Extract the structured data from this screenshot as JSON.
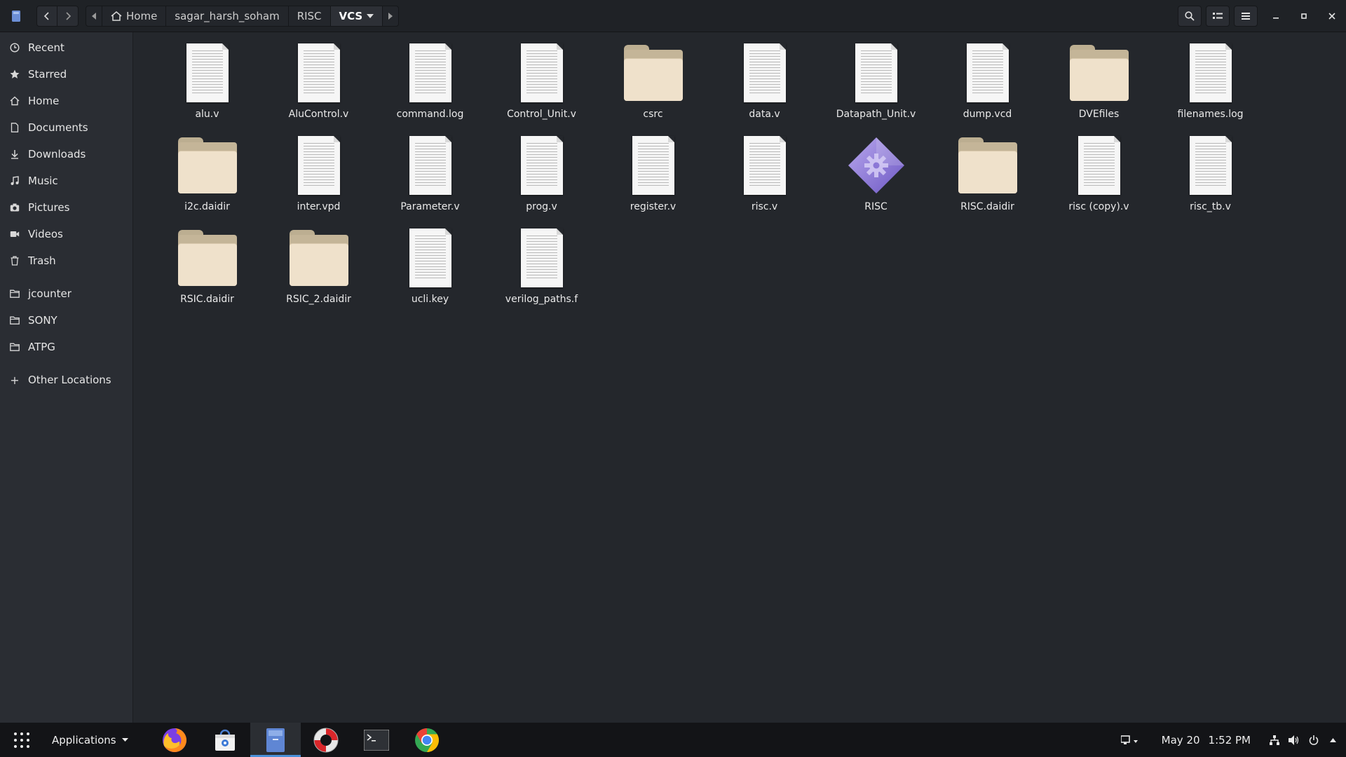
{
  "header": {
    "breadcrumbs": [
      {
        "label": "Home"
      },
      {
        "label": "sagar_harsh_soham"
      },
      {
        "label": "RISC"
      },
      {
        "label": "VCS",
        "current": true
      }
    ]
  },
  "sidebar": {
    "places": [
      {
        "label": "Recent",
        "icon": "clock-icon"
      },
      {
        "label": "Starred",
        "icon": "star-icon"
      },
      {
        "label": "Home",
        "icon": "home-icon"
      },
      {
        "label": "Documents",
        "icon": "document-icon"
      },
      {
        "label": "Downloads",
        "icon": "download-icon"
      },
      {
        "label": "Music",
        "icon": "music-icon"
      },
      {
        "label": "Pictures",
        "icon": "camera-icon"
      },
      {
        "label": "Videos",
        "icon": "video-icon"
      },
      {
        "label": "Trash",
        "icon": "trash-icon"
      }
    ],
    "bookmarks": [
      {
        "label": "jcounter",
        "icon": "folder-icon"
      },
      {
        "label": "SONY",
        "icon": "folder-icon"
      },
      {
        "label": "ATPG",
        "icon": "folder-icon"
      }
    ],
    "other": {
      "label": "Other Locations",
      "icon": "plus-icon"
    }
  },
  "files": [
    {
      "name": "alu.v",
      "type": "doc"
    },
    {
      "name": "AluControl.v",
      "type": "doc"
    },
    {
      "name": "command.log",
      "type": "doc"
    },
    {
      "name": "Control_Unit.v",
      "type": "doc"
    },
    {
      "name": "csrc",
      "type": "folder"
    },
    {
      "name": "data.v",
      "type": "doc"
    },
    {
      "name": "Datapath_Unit.v",
      "type": "doc"
    },
    {
      "name": "dump.vcd",
      "type": "doc"
    },
    {
      "name": "DVEfiles",
      "type": "folder"
    },
    {
      "name": "filenames.log",
      "type": "doc"
    },
    {
      "name": "i2c.daidir",
      "type": "folder"
    },
    {
      "name": "inter.vpd",
      "type": "doc"
    },
    {
      "name": "Parameter.v",
      "type": "doc"
    },
    {
      "name": "prog.v",
      "type": "doc"
    },
    {
      "name": "register.v",
      "type": "doc"
    },
    {
      "name": "risc.v",
      "type": "doc"
    },
    {
      "name": "RISC",
      "type": "exec"
    },
    {
      "name": "RISC.daidir",
      "type": "folder"
    },
    {
      "name": "risc (copy).v",
      "type": "doc"
    },
    {
      "name": "risc_tb.v",
      "type": "doc"
    },
    {
      "name": "RSIC.daidir",
      "type": "folder"
    },
    {
      "name": "RSIC_2.daidir",
      "type": "folder"
    },
    {
      "name": "ucli.key",
      "type": "doc"
    },
    {
      "name": "verilog_paths.f",
      "type": "doc"
    }
  ],
  "taskbar": {
    "applications_label": "Applications",
    "dock": [
      {
        "name": "firefox-icon"
      },
      {
        "name": "software-center-icon"
      },
      {
        "name": "files-icon",
        "active": true
      },
      {
        "name": "help-icon"
      },
      {
        "name": "terminal-icon"
      },
      {
        "name": "chrome-icon"
      }
    ],
    "date": "May 20",
    "time": "1:52 PM"
  },
  "colors": {
    "window_bg": "#24272c",
    "sidebar_bg": "#2a2d33",
    "taskbar_bg": "#131417",
    "accent": "#4a90d9"
  }
}
